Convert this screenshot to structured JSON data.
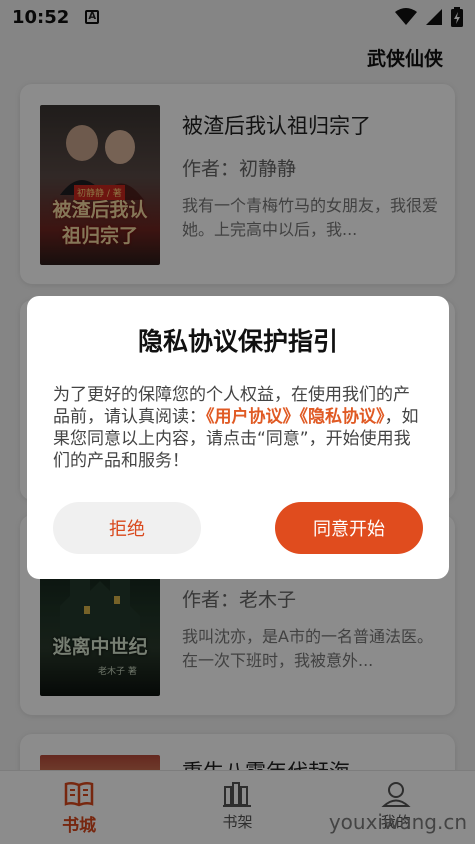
{
  "status_bar": {
    "time": "10:52",
    "notification_letter": "A"
  },
  "header": {
    "title": "武侠仙侠"
  },
  "books": [
    {
      "title": "被渣后我认祖归宗了",
      "author": "作者：初静静",
      "description": "我有一个青梅竹马的女朋友，我很爱她。上完高中以后，我...",
      "cover_text": "被渣后我认祖归宗了",
      "cover_author": "初静静 / 著"
    },
    {
      "title": "",
      "author": "作者：老木子",
      "description": "我叫沈亦，是A市的一名普通法医。在一次下班时，我被意外...",
      "cover_text": "逃离中世纪",
      "cover_author": "老木子 著"
    },
    {
      "title": "重生八零年代赶海",
      "cover_text": ""
    }
  ],
  "bottom_nav": {
    "items": [
      {
        "label": "书城",
        "active": true
      },
      {
        "label": "书架",
        "active": false
      },
      {
        "label": "我的",
        "active": false
      }
    ]
  },
  "dialog": {
    "title": "隐私协议保护指引",
    "body_pre": "为了更好的保障您的个人权益，在使用我们的产品前，请认真阅读：",
    "user_agreement": "《用户协议》",
    "privacy_policy": "《隐私协议》",
    "body_post": "，如果您同意以上内容，请点击“同意”，开始使用我们的产品和服务！",
    "reject_label": "拒绝",
    "agree_label": "同意开始"
  },
  "watermark": "youxiwang.cn",
  "colors": {
    "accent": "#e04c1e",
    "link": "#e05a24"
  }
}
